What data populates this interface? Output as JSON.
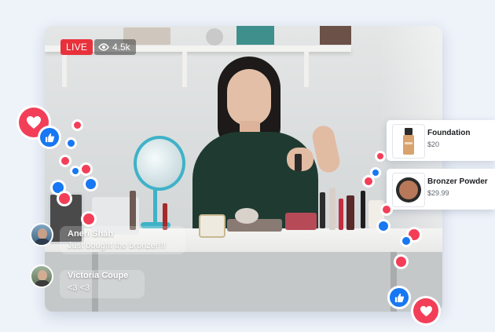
{
  "stream": {
    "live_label": "LIVE",
    "viewer_count": "4.5k"
  },
  "products": [
    {
      "name": "Foundation",
      "price": "$20",
      "icon": "foundation-bottle-icon"
    },
    {
      "name": "Bronzer Powder",
      "price": "$29.99",
      "icon": "bronzer-compact-icon"
    }
  ],
  "comments": [
    {
      "author": "Aneri Shah",
      "text": "Just bought the bronzer!!!"
    },
    {
      "author": "Victoria Coupe",
      "text": "<3 <3"
    }
  ],
  "colors": {
    "live_red": "#e8313b",
    "heart_red": "#f33e58",
    "like_blue": "#1877f2",
    "background": "#eef2f9"
  }
}
